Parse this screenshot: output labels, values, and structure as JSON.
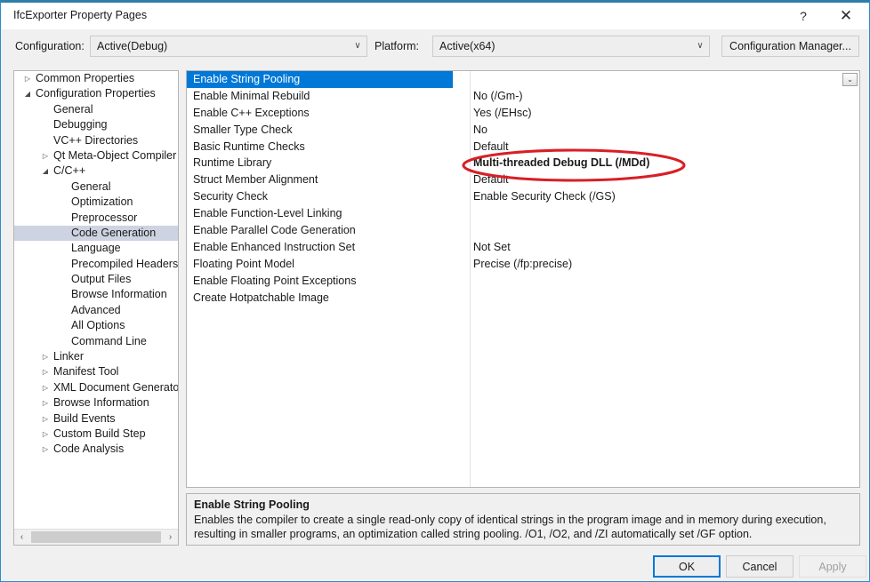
{
  "window": {
    "title": "IfcExporter Property Pages",
    "help_icon": "?",
    "close_icon": "✕",
    "accent_color": "#2d8ccb"
  },
  "toolbar": {
    "configuration_label": "Configuration:",
    "configuration_value": "Active(Debug)",
    "platform_label": "Platform:",
    "platform_value": "Active(x64)",
    "configuration_manager_label": "Configuration Manager...",
    "chevron_icon": "∨"
  },
  "tree": {
    "selected": "Code Generation",
    "expander_collapsed": "▷",
    "expander_expanded": "◢",
    "scrollbar": {
      "left_arrow": "‹",
      "right_arrow": "›"
    },
    "items": [
      {
        "label": "Common Properties",
        "depth": 0,
        "expander": "collapsed",
        "selected": false
      },
      {
        "label": "Configuration Properties",
        "depth": 0,
        "expander": "expanded",
        "selected": false
      },
      {
        "label": "General",
        "depth": 1,
        "expander": "none",
        "selected": false
      },
      {
        "label": "Debugging",
        "depth": 1,
        "expander": "none",
        "selected": false
      },
      {
        "label": "VC++ Directories",
        "depth": 1,
        "expander": "none",
        "selected": false
      },
      {
        "label": "Qt Meta-Object Compiler",
        "depth": 1,
        "expander": "collapsed",
        "selected": false
      },
      {
        "label": "C/C++",
        "depth": 1,
        "expander": "expanded",
        "selected": false
      },
      {
        "label": "General",
        "depth": 2,
        "expander": "none",
        "selected": false
      },
      {
        "label": "Optimization",
        "depth": 2,
        "expander": "none",
        "selected": false
      },
      {
        "label": "Preprocessor",
        "depth": 2,
        "expander": "none",
        "selected": false
      },
      {
        "label": "Code Generation",
        "depth": 2,
        "expander": "none",
        "selected": true
      },
      {
        "label": "Language",
        "depth": 2,
        "expander": "none",
        "selected": false
      },
      {
        "label": "Precompiled Headers",
        "depth": 2,
        "expander": "none",
        "selected": false
      },
      {
        "label": "Output Files",
        "depth": 2,
        "expander": "none",
        "selected": false
      },
      {
        "label": "Browse Information",
        "depth": 2,
        "expander": "none",
        "selected": false
      },
      {
        "label": "Advanced",
        "depth": 2,
        "expander": "none",
        "selected": false
      },
      {
        "label": "All Options",
        "depth": 2,
        "expander": "none",
        "selected": false
      },
      {
        "label": "Command Line",
        "depth": 2,
        "expander": "none",
        "selected": false
      },
      {
        "label": "Linker",
        "depth": 1,
        "expander": "collapsed",
        "selected": false
      },
      {
        "label": "Manifest Tool",
        "depth": 1,
        "expander": "collapsed",
        "selected": false
      },
      {
        "label": "XML Document Generator",
        "depth": 1,
        "expander": "collapsed",
        "selected": false
      },
      {
        "label": "Browse Information",
        "depth": 1,
        "expander": "collapsed",
        "selected": false
      },
      {
        "label": "Build Events",
        "depth": 1,
        "expander": "collapsed",
        "selected": false
      },
      {
        "label": "Custom Build Step",
        "depth": 1,
        "expander": "collapsed",
        "selected": false
      },
      {
        "label": "Code Analysis",
        "depth": 1,
        "expander": "collapsed",
        "selected": false
      }
    ]
  },
  "grid": {
    "selected_row": "Enable String Pooling",
    "dropdown_icon": "⌄",
    "rows": [
      {
        "name": "Enable String Pooling",
        "value": "",
        "selected": true,
        "bold": false
      },
      {
        "name": "Enable Minimal Rebuild",
        "value": "No (/Gm-)",
        "selected": false,
        "bold": false
      },
      {
        "name": "Enable C++ Exceptions",
        "value": "Yes (/EHsc)",
        "selected": false,
        "bold": false
      },
      {
        "name": "Smaller Type Check",
        "value": "No",
        "selected": false,
        "bold": false
      },
      {
        "name": "Basic Runtime Checks",
        "value": "Default",
        "selected": false,
        "bold": false
      },
      {
        "name": "Runtime Library",
        "value": "Multi-threaded Debug DLL (/MDd)",
        "selected": false,
        "bold": true
      },
      {
        "name": "Struct Member Alignment",
        "value": "Default",
        "selected": false,
        "bold": false
      },
      {
        "name": "Security Check",
        "value": "Enable Security Check (/GS)",
        "selected": false,
        "bold": false
      },
      {
        "name": "Enable Function-Level Linking",
        "value": "",
        "selected": false,
        "bold": false
      },
      {
        "name": "Enable Parallel Code Generation",
        "value": "",
        "selected": false,
        "bold": false
      },
      {
        "name": "Enable Enhanced Instruction Set",
        "value": "Not Set",
        "selected": false,
        "bold": false
      },
      {
        "name": "Floating Point Model",
        "value": "Precise (/fp:precise)",
        "selected": false,
        "bold": false
      },
      {
        "name": "Enable Floating Point Exceptions",
        "value": "",
        "selected": false,
        "bold": false
      },
      {
        "name": "Create Hotpatchable Image",
        "value": "",
        "selected": false,
        "bold": false
      }
    ]
  },
  "annotation": {
    "shape": "red-ellipse",
    "color": "#d81f26",
    "targets": "Multi-threaded Debug DLL (/MDd)"
  },
  "description": {
    "title": "Enable String Pooling",
    "body": "Enables the compiler to create a single read-only copy of identical strings in the program image and in memory during execution, resulting in smaller programs, an optimization called string pooling. /O1, /O2, and /ZI  automatically set /GF option."
  },
  "buttons": {
    "ok": "OK",
    "cancel": "Cancel",
    "apply": "Apply",
    "apply_enabled": false
  }
}
